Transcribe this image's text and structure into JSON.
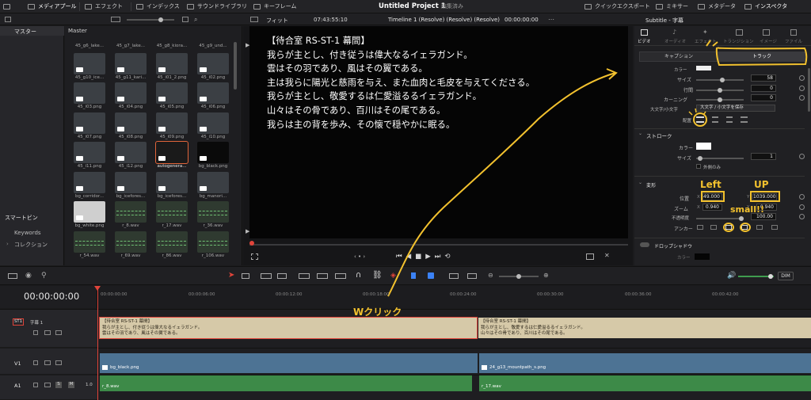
{
  "top_nav": {
    "media_pool": "メディアプール",
    "effects": "エフェクト",
    "index": "インデックス",
    "sound_library": "サウンドライブラリ",
    "keyframes": "キーフレーム",
    "project_title": "Untitled Project 1",
    "edited": "編集済み",
    "quick_export": "クイックエクスポート",
    "mixer": "ミキサー",
    "metadata": "メタデータ",
    "inspector": "インスペクタ"
  },
  "viewer_bar": {
    "fit": "フィット",
    "timecode_left": "07:43:55:10",
    "timeline_name": "Timeline 1 (Resolve) (Resolve) (Resolve)",
    "timecode_right": "00:00:00:00",
    "inspector_title": "Subtitle - 字幕"
  },
  "sidebar": {
    "master": "マスター",
    "smart_bins": "スマートビン",
    "keywords": "Keywords",
    "collections": "コレクション"
  },
  "media_pool": {
    "header": "Master",
    "row_labels_top": [
      "45_g6_lake...",
      "45_g7_lake...",
      "45_g8_kiora...",
      "45_g9_und..."
    ],
    "items": [
      {
        "label": "45_g10_ice...",
        "kind": "img"
      },
      {
        "label": "45_g11_kari...",
        "kind": "img"
      },
      {
        "label": "45_i01_2.png",
        "kind": "img"
      },
      {
        "label": "45_i02.png",
        "kind": "img"
      },
      {
        "label": "45_i03.png",
        "kind": "img"
      },
      {
        "label": "45_i04.png",
        "kind": "img"
      },
      {
        "label": "45_i05.png",
        "kind": "img"
      },
      {
        "label": "45_i06.png",
        "kind": "img"
      },
      {
        "label": "45_i07.png",
        "kind": "img"
      },
      {
        "label": "45_i08.png",
        "kind": "img"
      },
      {
        "label": "45_i09.png",
        "kind": "img"
      },
      {
        "label": "45_i10.png",
        "kind": "img"
      },
      {
        "label": "45_i11.png",
        "kind": "img"
      },
      {
        "label": "45_i12.png",
        "kind": "img"
      },
      {
        "label": "autogenera...",
        "kind": "sel"
      },
      {
        "label": "bg_black.png",
        "kind": "black"
      },
      {
        "label": "bg_corridor...",
        "kind": "img"
      },
      {
        "label": "bg_icefores...",
        "kind": "img"
      },
      {
        "label": "bg_icefores...",
        "kind": "img"
      },
      {
        "label": "bg_manori...",
        "kind": "img"
      },
      {
        "label": "bg_white.png",
        "kind": "white"
      },
      {
        "label": "r_8.wav",
        "kind": "wave"
      },
      {
        "label": "r_17.wav",
        "kind": "wave"
      },
      {
        "label": "r_36.wav",
        "kind": "wave"
      },
      {
        "label": "r_54.wav",
        "kind": "wave"
      },
      {
        "label": "r_69.wav",
        "kind": "wave"
      },
      {
        "label": "r_86.wav",
        "kind": "wave"
      },
      {
        "label": "r_106.wav",
        "kind": "wave"
      }
    ]
  },
  "viewer": {
    "lines": [
      "【待合室 RS-ST-1 幕間】",
      "我らが主とし、付き従うは偉大なるイェラガンド。",
      "雲はその羽であり、風はその翼である。",
      "主は我らに陽光と慈雨を与え、また血肉と毛皮を与えてくださる。",
      "我らが主とし、敬愛するは仁愛溢るるイェラガンド。",
      "山々はその骨であり、百川はその尾である。",
      "我らは主の背を歩み、その懐で穏やかに眠る。"
    ]
  },
  "inspector": {
    "tabs": [
      "ビデオ",
      "オーディオ",
      "エフェクト",
      "トランジション",
      "イメージ",
      "ファイル"
    ],
    "caption_btn": "キャプション",
    "track_btn": "トラック",
    "color_label": "カラー",
    "size_label": "サイズ",
    "size_value": "58",
    "line_spacing_label": "行間",
    "line_spacing_value": "0",
    "kerning_label": "カーニング",
    "kerning_value": "0",
    "case_label": "大文字/小文字",
    "case_value": "大文字 / 小文字を保存",
    "align_label": "配置",
    "stroke_head": "ストローク",
    "stroke_color_label": "カラー",
    "stroke_size_label": "サイズ",
    "stroke_size_value": "1",
    "outside_only": "外側のみ",
    "transform_head": "変形",
    "position_label": "位置",
    "pos_x": "49.000",
    "pos_y": "1039.000",
    "zoom_label": "ズーム",
    "zoom_x": "0.940",
    "zoom_y": "0.940",
    "opacity_label": "不透明度",
    "opacity_value": "100.00",
    "anchor_label": "アンカー",
    "drop_shadow": "ドロップシャドウ",
    "ds_color": "カラー",
    "x_label": "X",
    "y_label": "Y"
  },
  "timeline": {
    "timecode": "00:00:00:00",
    "dim": "DIM",
    "ruler": [
      "00:00:00:00",
      "00:00:06:00",
      "00:00:12:00",
      "00:00:18:00",
      "00:00:24:00",
      "00:00:30:00",
      "00:00:36:00",
      "00:00:42:00"
    ],
    "tracks": {
      "st1": "ST1",
      "st1_name": "字幕 1",
      "v1": "V1",
      "a1": "A1",
      "a1_level": "1.0"
    },
    "clip1_text": [
      "【待合室 RS-ST-1 幕間】",
      "我らが主とし、付き従うは偉大なるイェラガンド。",
      "雲はその羽であり、風はその翼である。"
    ],
    "clip2_text": [
      "【待合室 RS-ST-1 幕間】",
      "我らが主とし、敬愛するは仁愛溢るるイェラガンド。",
      "山々はその骨であり、百川はその尾である。"
    ],
    "video_clip1": "bg_black.png",
    "video_clip2": "24_g13_mountpath_s.png",
    "audio_clip1": "r_8.wav",
    "audio_clip2": "r_17.wav"
  },
  "annotations": {
    "left": "Left",
    "up": "UP",
    "small": "small!!",
    "double_click": "Wクリック"
  },
  "colors": {
    "accent": "#f2c12e",
    "playhead": "#e0443a",
    "title_clip": "#d6c9a8",
    "video_clip": "#4d7394",
    "audio_clip": "#3d8a48"
  }
}
